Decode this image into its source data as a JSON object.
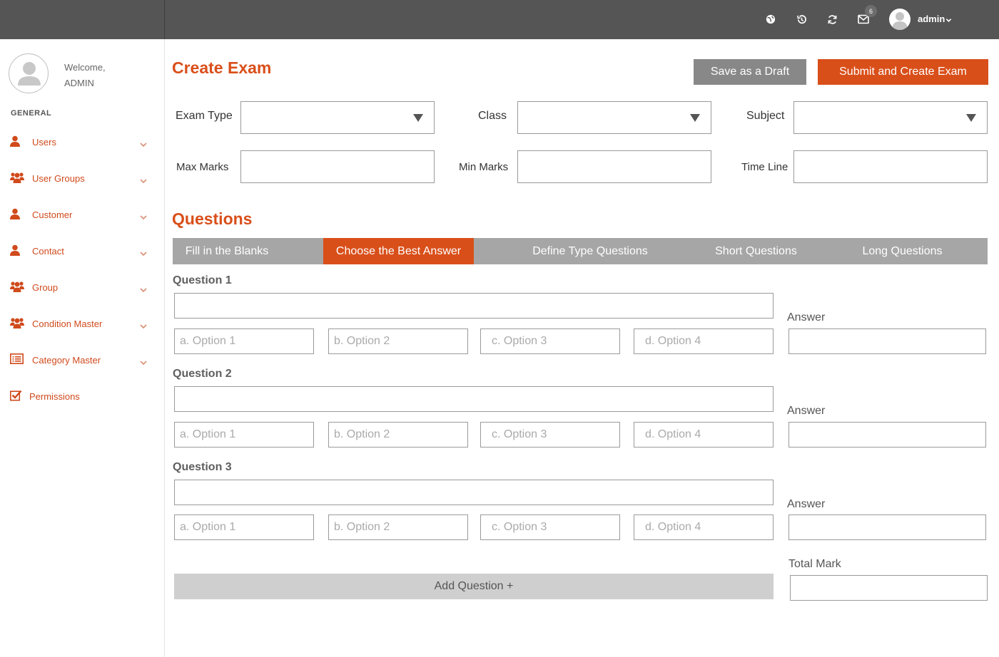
{
  "topbar": {
    "notification_count": "6",
    "user_name": "admin",
    "icons": [
      "globe-icon",
      "history-icon",
      "refresh-icon",
      "mail-icon"
    ]
  },
  "sidebar": {
    "welcome": "Welcome,",
    "user": "ADMIN",
    "section": "GENERAL",
    "items": [
      {
        "label": "Users",
        "icon": "user-icon"
      },
      {
        "label": "User Groups",
        "icon": "users-icon"
      },
      {
        "label": "Customer",
        "icon": "user-icon"
      },
      {
        "label": "Contact",
        "icon": "user-icon"
      },
      {
        "label": "Group",
        "icon": "users-icon"
      },
      {
        "label": "Condition Master",
        "icon": "users-icon"
      },
      {
        "label": "Category Master",
        "icon": "list-icon"
      },
      {
        "label": "Permissions",
        "icon": "checkbox-icon"
      }
    ]
  },
  "page": {
    "title": "Create Exam",
    "draft_button": "Save as a Draft",
    "submit_button": "Submit and Create Exam"
  },
  "form": {
    "exam_type_label": "Exam Type",
    "class_label": "Class",
    "subject_label": "Subject",
    "max_marks_label": "Max Marks",
    "min_marks_label": "Min Marks",
    "time_line_label": "Time Line"
  },
  "questions": {
    "title": "Questions",
    "tabs": [
      {
        "label": "Fill in the Blanks",
        "active": false
      },
      {
        "label": "Choose the Best Answer",
        "active": true
      },
      {
        "label": "Define Type Questions",
        "active": false
      },
      {
        "label": "Short Questions",
        "active": false
      },
      {
        "label": "Long Questions",
        "active": false
      }
    ],
    "items": [
      {
        "label": "Question 1",
        "options": [
          "a. Option 1",
          "b. Option 2",
          "c. Option 3",
          "d. Option 4"
        ],
        "answer_label": "Answer"
      },
      {
        "label": "Question 2",
        "options": [
          "a. Option 1",
          "b. Option 2",
          "c. Option 3",
          "d. Option 4"
        ],
        "answer_label": "Answer"
      },
      {
        "label": "Question 3",
        "options": [
          "a. Option 1",
          "b. Option 2",
          "c. Option 3",
          "d. Option 4"
        ],
        "answer_label": "Answer"
      }
    ],
    "add_button": "Add Question +",
    "total_mark_label": "Total Mark"
  },
  "colors": {
    "accent": "#d94f1a",
    "topbar": "#555555",
    "tab_bar": "#a6a6a6",
    "draft_button": "#888888"
  }
}
